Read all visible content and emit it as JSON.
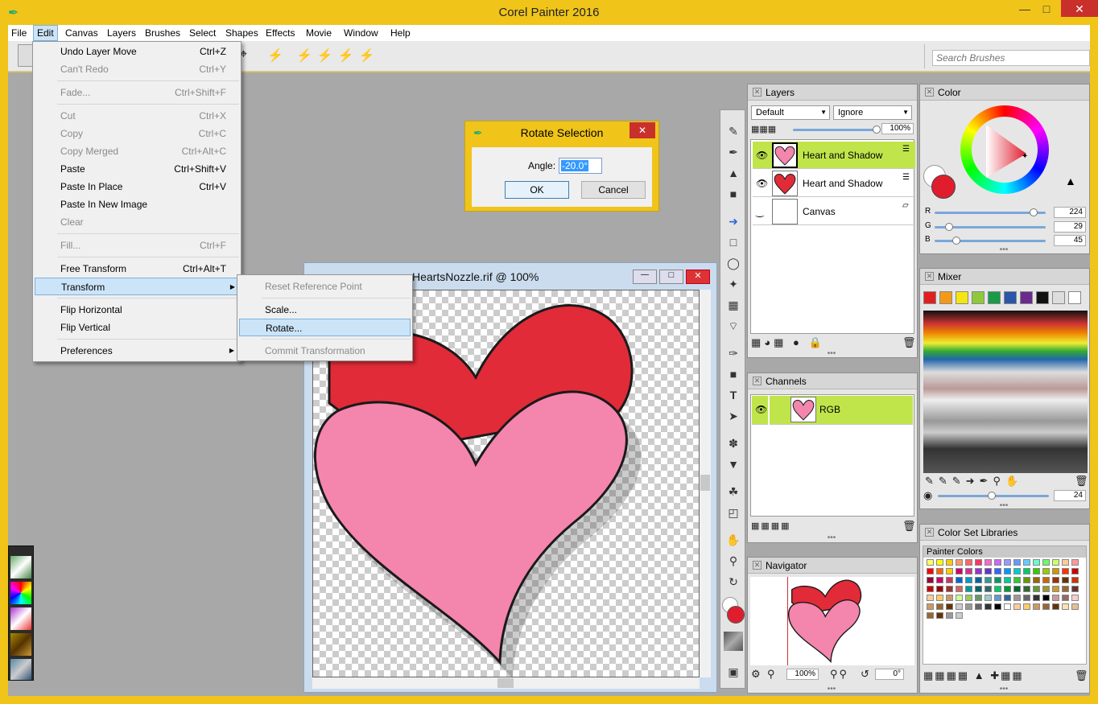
{
  "app": {
    "title": "Corel Painter 2016"
  },
  "menubar": [
    "File",
    "Edit",
    "Canvas",
    "Layers",
    "Brushes",
    "Select",
    "Shapes",
    "Effects",
    "Movie",
    "Window",
    "Help"
  ],
  "search": {
    "placeholder": "Search Brushes"
  },
  "edit_menu": [
    {
      "label": "Undo Layer Move",
      "shortcut": "Ctrl+Z",
      "disabled": false
    },
    {
      "label": "Can't Redo",
      "shortcut": "Ctrl+Y",
      "disabled": true
    },
    {
      "label": "Fade...",
      "shortcut": "Ctrl+Shift+F",
      "disabled": true
    },
    {
      "label": "Cut",
      "shortcut": "Ctrl+X",
      "disabled": true
    },
    {
      "label": "Copy",
      "shortcut": "Ctrl+C",
      "disabled": true
    },
    {
      "label": "Copy Merged",
      "shortcut": "Ctrl+Alt+C",
      "disabled": true
    },
    {
      "label": "Paste",
      "shortcut": "Ctrl+Shift+V",
      "disabled": false
    },
    {
      "label": "Paste In Place",
      "shortcut": "Ctrl+V",
      "disabled": false
    },
    {
      "label": "Paste In New Image",
      "shortcut": "",
      "disabled": false
    },
    {
      "label": "Clear",
      "shortcut": "",
      "disabled": true
    },
    {
      "label": "Fill...",
      "shortcut": "Ctrl+F",
      "disabled": true
    },
    {
      "label": "Free Transform",
      "shortcut": "Ctrl+Alt+T",
      "disabled": false
    },
    {
      "label": "Transform",
      "shortcut": "",
      "disabled": false
    },
    {
      "label": "Flip Horizontal",
      "shortcut": "",
      "disabled": false
    },
    {
      "label": "Flip Vertical",
      "shortcut": "",
      "disabled": false
    },
    {
      "label": "Preferences",
      "shortcut": "",
      "disabled": false
    }
  ],
  "transform_submenu": [
    {
      "label": "Reset Reference Point",
      "disabled": true
    },
    {
      "label": "Scale...",
      "disabled": false
    },
    {
      "label": "Rotate...",
      "disabled": false
    },
    {
      "label": "Commit Transformation",
      "disabled": true
    }
  ],
  "dialog": {
    "title": "Rotate Selection",
    "angle_label": "Angle:",
    "angle_value": "-20.0°",
    "ok": "OK",
    "cancel": "Cancel"
  },
  "document": {
    "title": "HeartsNozzle.rif @ 100%"
  },
  "layers_panel": {
    "title": "Layers",
    "composite_method": "Default",
    "preserve": "Ignore",
    "opacity": "100%",
    "rows": [
      {
        "name": "Heart and Shadow"
      },
      {
        "name": "Heart and Shadow"
      },
      {
        "name": "Canvas"
      }
    ]
  },
  "channels_panel": {
    "title": "Channels",
    "rows": [
      {
        "name": "RGB"
      }
    ]
  },
  "navigator_panel": {
    "title": "Navigator",
    "zoom": "100%",
    "rotation": "0°"
  },
  "color_panel": {
    "title": "Color",
    "r_label": "R",
    "g_label": "G",
    "b_label": "B",
    "r": "224",
    "g": "29",
    "b": "45",
    "main_color": "#e01d2d"
  },
  "mixer_panel": {
    "title": "Mixer",
    "size": "24",
    "swatches": [
      "#e02020",
      "#f29a17",
      "#f4e612",
      "#8fc93a",
      "#1a9a4a",
      "#2a55a8",
      "#6a2b8c",
      "#111111",
      "#dddddd",
      "#ffffff"
    ]
  },
  "colorset_panel": {
    "title": "Color Set Libraries",
    "library": "Painter Colors"
  }
}
